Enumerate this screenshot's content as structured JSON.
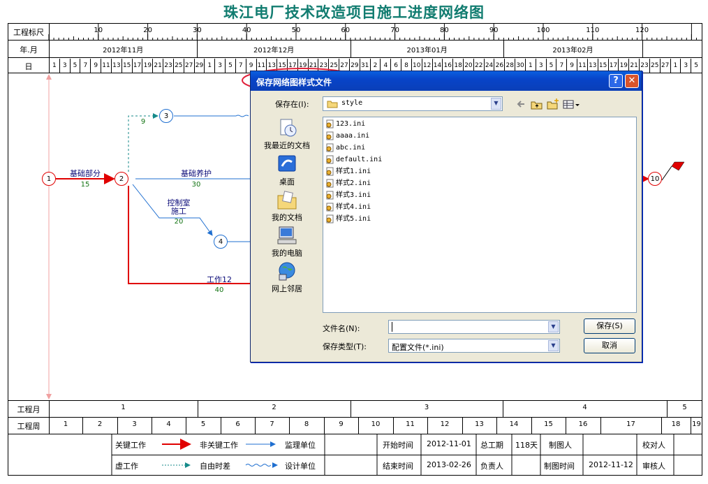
{
  "page_title": "珠江电厂技术改造项目施工进度网络图",
  "row_labels": {
    "ruler": "工程标尺",
    "month": "年.月",
    "day": "日",
    "proj_month": "工程月",
    "proj_week": "工程周"
  },
  "ruler_numbers": [
    "10",
    "20",
    "30",
    "40",
    "50",
    "60",
    "70",
    "80",
    "90",
    "100",
    "110",
    "120"
  ],
  "months": [
    "2012年11月",
    "2012年12月",
    "2013年01月",
    "2013年02月"
  ],
  "days": [
    "1",
    "3",
    "5",
    "7",
    "9",
    "11",
    "13",
    "15",
    "17",
    "19",
    "21",
    "23",
    "25",
    "27",
    "29",
    "1",
    "3",
    "5",
    "7",
    "9",
    "11",
    "13",
    "15",
    "17",
    "19",
    "21",
    "23",
    "25",
    "27",
    "29",
    "31",
    "2",
    "4",
    "6",
    "8",
    "10",
    "12",
    "14",
    "16",
    "18",
    "20",
    "22",
    "24",
    "26",
    "28",
    "30",
    "1",
    "3",
    "5",
    "7",
    "9",
    "11",
    "13",
    "15",
    "17",
    "19",
    "21",
    "23",
    "25",
    "27",
    "1",
    "3",
    "5"
  ],
  "project_months": [
    "1",
    "2",
    "3",
    "4",
    "5"
  ],
  "project_weeks": [
    "1",
    "2",
    "3",
    "4",
    "5",
    "6",
    "7",
    "8",
    "9",
    "10",
    "11",
    "12",
    "13",
    "14",
    "15",
    "16",
    "17",
    "18",
    "19"
  ],
  "nodes": [
    "1",
    "2",
    "3",
    "4",
    "10"
  ],
  "tasks": {
    "t12": {
      "name": "基础部分",
      "dur": "15"
    },
    "t2_3": {
      "dur": "9"
    },
    "t2_x": {
      "name": "基础养护",
      "dur": "30"
    },
    "t2_4": {
      "name": "控制室\n施工",
      "dur": "20"
    },
    "t12b": {
      "name": "工作12",
      "dur": "40"
    }
  },
  "legend": {
    "critical": "关键工作",
    "noncritical": "非关键工作",
    "virtual": "虚工作",
    "free_float": "自由时差",
    "supervisor": "监理单位",
    "designer": "设计单位",
    "start_label": "开始时间",
    "start_value": "2012-11-01",
    "end_label": "结束时间",
    "end_value": "2013-02-26",
    "duration_label": "总工期",
    "duration_value": "118天",
    "owner_label": "负责人",
    "drawer_label": "制图人",
    "draw_time_label": "制图时间",
    "draw_time_value": "2012-11-12",
    "checker_label": "校对人",
    "reviewer_label": "审核人"
  },
  "dialog": {
    "title": "保存网络图样式文件",
    "help": "?",
    "close": "✕",
    "save_in_label": "保存在(I):",
    "save_in_value": "style",
    "places": [
      "我最近的文档",
      "桌面",
      "我的文档",
      "我的电脑",
      "网上邻居"
    ],
    "files": [
      "123.ini",
      "aaaa.ini",
      "abc.ini",
      "default.ini",
      "样式1.ini",
      "样式2.ini",
      "样式3.ini",
      "样式4.ini",
      "样式5.ini"
    ],
    "filename_label": "文件名(N):",
    "filename_value": "",
    "filetype_label": "保存类型(T):",
    "filetype_value": "配置文件(*.ini)",
    "save_button": "保存(S)",
    "cancel_button": "取消"
  },
  "colors": {
    "title": "#117c70",
    "critical": "#e00000",
    "noncritical": "#1f6fd0",
    "virtual": "#158a8a",
    "highlight_circle": "#e0203a"
  }
}
